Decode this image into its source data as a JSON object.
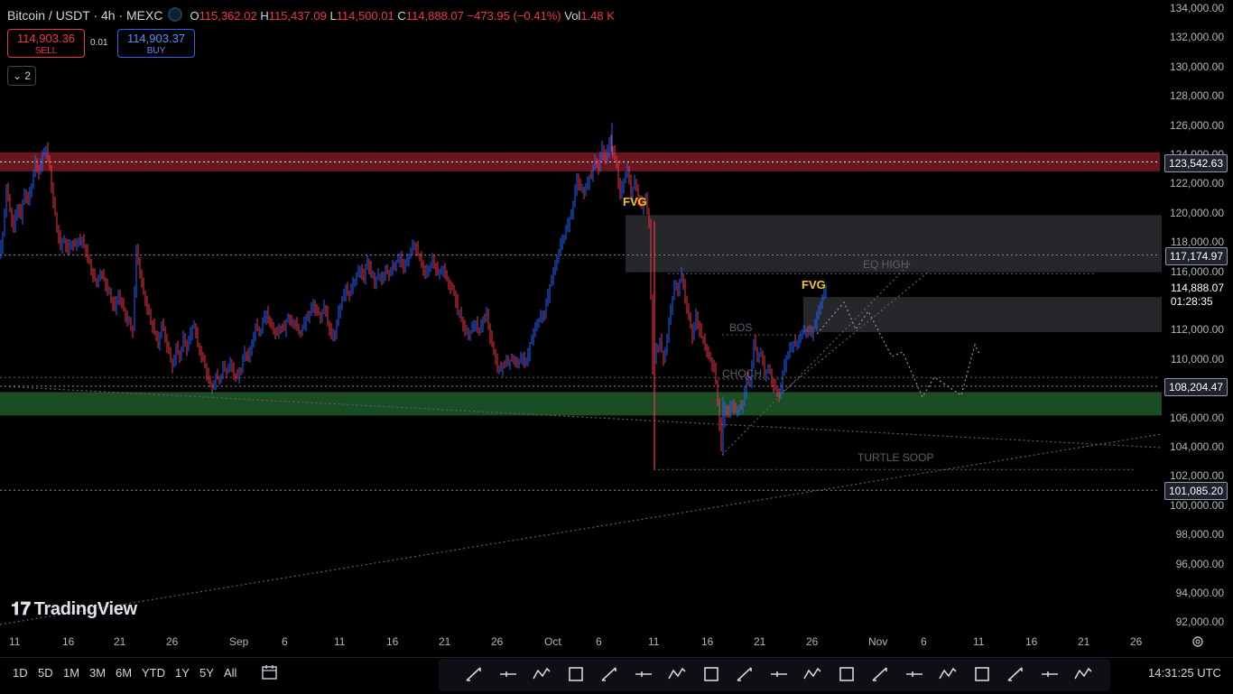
{
  "header": {
    "symbol": "Bitcoin / USDT · 4h · MEXC",
    "open_key": "O",
    "open": "115,362.02",
    "high_key": "H",
    "high": "115,437.09",
    "low_key": "L",
    "low": "114,500.01",
    "close_key": "C",
    "close": "114,888.07",
    "change": "−473.95 (−0.41%)",
    "vol_key": "Vol",
    "vol": "1.48 K"
  },
  "trade": {
    "sell_price": "114,903.36",
    "sell_label": "SELL",
    "spread": "0.01",
    "buy_price": "114,903.37",
    "buy_label": "BUY",
    "collapse_label": "⌄ 2"
  },
  "price_axis": {
    "ticks": [
      "134,000.00",
      "132,000.00",
      "130,000.00",
      "128,000.00",
      "126,000.00",
      "124,000.00",
      "122,000.00",
      "120,000.00",
      "118,000.00",
      "116,000.00",
      "114,000.00",
      "112,000.00",
      "110,000.00",
      "108,000.00",
      "106,000.00",
      "104,000.00",
      "102,000.00",
      "100,000.00",
      "98,000.00",
      "96,000.00",
      "94,000.00",
      "92,000.00"
    ],
    "labels": {
      "resistance": "123,542.63",
      "eq": "117,174.97",
      "last": "114,888.07",
      "countdown": "01:28:35",
      "support": "108,204.47",
      "low": "101,085.20"
    }
  },
  "time_axis": [
    "11",
    "16",
    "21",
    "26",
    "Sep",
    "6",
    "11",
    "16",
    "21",
    "26",
    "Oct",
    "6",
    "11",
    "16",
    "21",
    "26",
    "Nov",
    "6",
    "11",
    "16",
    "21",
    "26"
  ],
  "annotations": {
    "fvg1": "FVG",
    "fvg2": "FVG",
    "bos": "BOS",
    "choch": "CHOCH",
    "eq_high": "EQ HIGH",
    "turtle": "TURTLE SOOP"
  },
  "bottom": {
    "timeframes": [
      "1D",
      "5D",
      "1M",
      "3M",
      "6M",
      "YTD",
      "1Y",
      "5Y",
      "All"
    ],
    "clock": "14:31:25 UTC"
  },
  "logo": {
    "text": "TradingView"
  },
  "colors": {
    "up": "#2962ff",
    "down": "#f23645",
    "resistance_zone": "#7a1a22",
    "support_zone": "#1f5a2a",
    "fvg": "#f5c518"
  },
  "chart_data": {
    "type": "candlestick",
    "ylim": [
      91000,
      134600
    ],
    "close_path": [
      [
        0,
        117000
      ],
      [
        4,
        118500
      ],
      [
        8,
        121800
      ],
      [
        12,
        120200
      ],
      [
        16,
        119000
      ],
      [
        20,
        120500
      ],
      [
        24,
        119800
      ],
      [
        28,
        121500
      ],
      [
        32,
        120800
      ],
      [
        36,
        122000
      ],
      [
        40,
        123500
      ],
      [
        44,
        122800
      ],
      [
        48,
        124000
      ],
      [
        52,
        124500
      ],
      [
        56,
        123000
      ],
      [
        60,
        120800
      ],
      [
        64,
        119000
      ],
      [
        68,
        117800
      ],
      [
        72,
        118200
      ],
      [
        76,
        117500
      ],
      [
        80,
        118000
      ],
      [
        84,
        117800
      ],
      [
        88,
        118200
      ],
      [
        92,
        118100
      ],
      [
        96,
        117500
      ],
      [
        100,
        116500
      ],
      [
        104,
        115800
      ],
      [
        108,
        115200
      ],
      [
        112,
        116000
      ],
      [
        116,
        115500
      ],
      [
        120,
        114800
      ],
      [
        124,
        114200
      ],
      [
        128,
        113500
      ],
      [
        132,
        114500
      ],
      [
        136,
        113800
      ],
      [
        140,
        113000
      ],
      [
        144,
        112500
      ],
      [
        148,
        112000
      ],
      [
        152,
        117500
      ],
      [
        156,
        116000
      ],
      [
        160,
        114500
      ],
      [
        164,
        113600
      ],
      [
        168,
        112600
      ],
      [
        172,
        112000
      ],
      [
        176,
        111000
      ],
      [
        180,
        112500
      ],
      [
        184,
        111500
      ],
      [
        188,
        110500
      ],
      [
        192,
        109500
      ],
      [
        196,
        110800
      ],
      [
        200,
        110200
      ],
      [
        204,
        111500
      ],
      [
        208,
        110800
      ],
      [
        212,
        111800
      ],
      [
        216,
        112500
      ],
      [
        220,
        111000
      ],
      [
        224,
        110300
      ],
      [
        228,
        109600
      ],
      [
        232,
        108600
      ],
      [
        236,
        108000
      ],
      [
        240,
        108900
      ],
      [
        244,
        108600
      ],
      [
        248,
        109500
      ],
      [
        252,
        109200
      ],
      [
        256,
        109800
      ],
      [
        260,
        109000
      ],
      [
        264,
        108800
      ],
      [
        268,
        109500
      ],
      [
        272,
        110500
      ],
      [
        276,
        110200
      ],
      [
        280,
        111000
      ],
      [
        284,
        112400
      ],
      [
        288,
        111800
      ],
      [
        292,
        112600
      ],
      [
        296,
        113200
      ],
      [
        300,
        112500
      ],
      [
        304,
        112000
      ],
      [
        308,
        111800
      ],
      [
        312,
        112300
      ],
      [
        316,
        112100
      ],
      [
        320,
        113000
      ],
      [
        324,
        112400
      ],
      [
        328,
        112600
      ],
      [
        332,
        111800
      ],
      [
        336,
        112200
      ],
      [
        340,
        112800
      ],
      [
        344,
        113200
      ],
      [
        348,
        113800
      ],
      [
        352,
        113300
      ],
      [
        356,
        112900
      ],
      [
        360,
        113700
      ],
      [
        364,
        112600
      ],
      [
        368,
        111600
      ],
      [
        372,
        111800
      ],
      [
        376,
        113200
      ],
      [
        380,
        114200
      ],
      [
        384,
        114800
      ],
      [
        388,
        114500
      ],
      [
        392,
        115200
      ],
      [
        396,
        115800
      ],
      [
        400,
        116200
      ],
      [
        404,
        115600
      ],
      [
        408,
        116800
      ],
      [
        412,
        115900
      ],
      [
        416,
        115300
      ],
      [
        420,
        115800
      ],
      [
        424,
        115500
      ],
      [
        428,
        116100
      ],
      [
        432,
        115900
      ],
      [
        436,
        116300
      ],
      [
        440,
        116700
      ],
      [
        444,
        117000
      ],
      [
        448,
        116300
      ],
      [
        452,
        116800
      ],
      [
        456,
        117500
      ],
      [
        460,
        117900
      ],
      [
        464,
        117300
      ],
      [
        468,
        116600
      ],
      [
        472,
        115800
      ],
      [
        476,
        116300
      ],
      [
        480,
        116800
      ],
      [
        484,
        116200
      ],
      [
        488,
        115900
      ],
      [
        492,
        116300
      ],
      [
        496,
        115400
      ],
      [
        500,
        115000
      ],
      [
        504,
        114600
      ],
      [
        508,
        113400
      ],
      [
        512,
        112800
      ],
      [
        516,
        112000
      ],
      [
        520,
        111700
      ],
      [
        524,
        112200
      ],
      [
        528,
        112500
      ],
      [
        532,
        111900
      ],
      [
        536,
        112800
      ],
      [
        540,
        113100
      ],
      [
        544,
        111600
      ],
      [
        548,
        110500
      ],
      [
        552,
        109500
      ],
      [
        556,
        109300
      ],
      [
        560,
        109900
      ],
      [
        564,
        109800
      ],
      [
        568,
        110100
      ],
      [
        572,
        109800
      ],
      [
        576,
        109900
      ],
      [
        580,
        110200
      ],
      [
        584,
        109700
      ],
      [
        588,
        111100
      ],
      [
        592,
        111800
      ],
      [
        596,
        112600
      ],
      [
        600,
        112900
      ],
      [
        604,
        113200
      ],
      [
        608,
        114400
      ],
      [
        612,
        115600
      ],
      [
        616,
        116400
      ],
      [
        620,
        117500
      ],
      [
        624,
        118200
      ],
      [
        628,
        118900
      ],
      [
        632,
        119600
      ],
      [
        636,
        120600
      ],
      [
        640,
        122500
      ],
      [
        644,
        121700
      ],
      [
        648,
        121500
      ],
      [
        652,
        122100
      ],
      [
        656,
        122700
      ],
      [
        660,
        123600
      ],
      [
        664,
        123200
      ],
      [
        668,
        124500
      ],
      [
        672,
        123700
      ],
      [
        676,
        124900
      ],
      [
        680,
        124200
      ],
      [
        684,
        123300
      ],
      [
        688,
        121200
      ],
      [
        692,
        122300
      ],
      [
        696,
        123100
      ],
      [
        700,
        121300
      ],
      [
        704,
        122200
      ],
      [
        708,
        121100
      ],
      [
        712,
        120400
      ],
      [
        716,
        121200
      ],
      [
        720,
        119200
      ],
      [
        724,
        109500
      ],
      [
        728,
        110700
      ],
      [
        732,
        111300
      ],
      [
        736,
        109900
      ],
      [
        740,
        111500
      ],
      [
        744,
        113500
      ],
      [
        748,
        115100
      ],
      [
        752,
        114800
      ],
      [
        756,
        115900
      ],
      [
        760,
        114200
      ],
      [
        764,
        112900
      ],
      [
        768,
        111600
      ],
      [
        772,
        113000
      ],
      [
        776,
        112000
      ],
      [
        780,
        111300
      ],
      [
        784,
        110600
      ],
      [
        788,
        109900
      ],
      [
        792,
        109500
      ],
      [
        796,
        107200
      ],
      [
        800,
        104000
      ],
      [
        804,
        106800
      ],
      [
        808,
        106300
      ],
      [
        812,
        107100
      ],
      [
        816,
        106400
      ],
      [
        820,
        106800
      ],
      [
        824,
        106900
      ],
      [
        828,
        108800
      ],
      [
        832,
        108300
      ],
      [
        836,
        111300
      ],
      [
        840,
        110100
      ],
      [
        844,
        110600
      ],
      [
        848,
        109000
      ],
      [
        852,
        109500
      ],
      [
        856,
        108500
      ],
      [
        860,
        108000
      ],
      [
        864,
        107500
      ],
      [
        868,
        109000
      ],
      [
        872,
        110200
      ],
      [
        876,
        110700
      ],
      [
        880,
        111200
      ],
      [
        884,
        111000
      ],
      [
        888,
        111800
      ],
      [
        892,
        111900
      ],
      [
        896,
        112000
      ],
      [
        900,
        111800
      ],
      [
        904,
        112500
      ],
      [
        908,
        113400
      ],
      [
        912,
        114300
      ],
      [
        916,
        114900
      ]
    ]
  }
}
